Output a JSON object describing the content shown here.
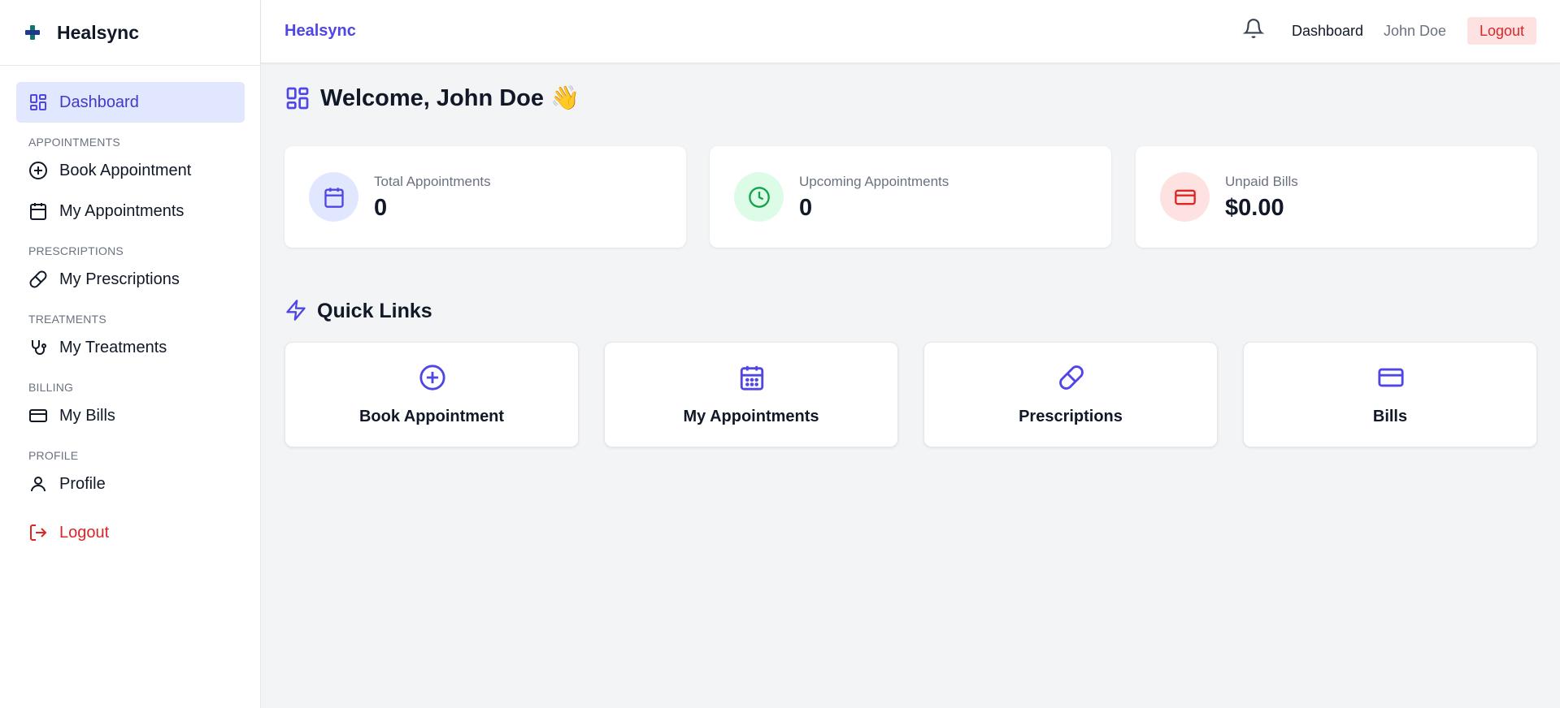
{
  "brand": {
    "name": "Healsync",
    "accent": "#4f46e5"
  },
  "sidebar": {
    "dashboard": "Dashboard",
    "sections": {
      "appointments": "APPOINTMENTS",
      "prescriptions": "PRESCRIPTIONS",
      "treatments": "TREATMENTS",
      "billing": "BILLING",
      "profile": "PROFILE"
    },
    "items": {
      "book_appointment": "Book Appointment",
      "my_appointments": "My Appointments",
      "my_prescriptions": "My Prescriptions",
      "my_treatments": "My Treatments",
      "my_bills": "My Bills",
      "profile": "Profile",
      "logout": "Logout"
    }
  },
  "header": {
    "title": "Healsync",
    "dashboard_link": "Dashboard",
    "user_name": "John Doe",
    "logout": "Logout"
  },
  "main": {
    "welcome": "Welcome, John Doe 👋",
    "stats": [
      {
        "label": "Total Appointments",
        "value": "0",
        "icon": "calendar-icon",
        "color": "#4f46e5",
        "bg": "#e0e7ff"
      },
      {
        "label": "Upcoming Appointments",
        "value": "0",
        "icon": "clock-icon",
        "color": "#16a34a",
        "bg": "#dcfce7"
      },
      {
        "label": "Unpaid Bills",
        "value": "$0.00",
        "icon": "credit-card-icon",
        "color": "#dc2626",
        "bg": "#fee2e2"
      }
    ],
    "quick_links_title": "Quick Links",
    "quick_links": [
      {
        "label": "Book Appointment",
        "icon": "plus-circle-icon"
      },
      {
        "label": "My Appointments",
        "icon": "calendar-grid-icon"
      },
      {
        "label": "Prescriptions",
        "icon": "pill-icon"
      },
      {
        "label": "Bills",
        "icon": "credit-card-icon"
      }
    ]
  }
}
